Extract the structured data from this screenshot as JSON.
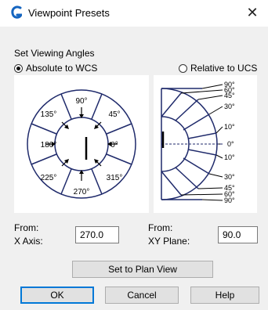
{
  "window": {
    "title": "Viewpoint Presets",
    "close_glyph": "✕",
    "app_icon": "G"
  },
  "viewing": {
    "section_label": "Set Viewing Angles",
    "absolute_label": "Absolute to WCS",
    "relative_label": "Relative to UCS",
    "selected": "absolute"
  },
  "xy_dial": {
    "labels": [
      "0°",
      "45°",
      "90°",
      "135°",
      "180°",
      "225°",
      "270°",
      "315°"
    ],
    "value": 270
  },
  "plane_dial": {
    "labels": [
      "90°",
      "60°",
      "45°",
      "30°",
      "10°",
      "0°",
      "10°",
      "30°",
      "45°",
      "60°",
      "90°"
    ],
    "value": 90
  },
  "fields": {
    "x_from": "From:",
    "x_axis_label": "X Axis:",
    "x_axis_value": "270.0",
    "xy_from": "From:",
    "xy_plane_label": "XY Plane:",
    "xy_plane_value": "90.0"
  },
  "buttons": {
    "plan_view": "Set to Plan View",
    "ok": "OK",
    "cancel": "Cancel",
    "help": "Help"
  },
  "colors": {
    "dial": "#1f2a6b",
    "accent": "#0078d7",
    "icon": "#1565c0"
  }
}
